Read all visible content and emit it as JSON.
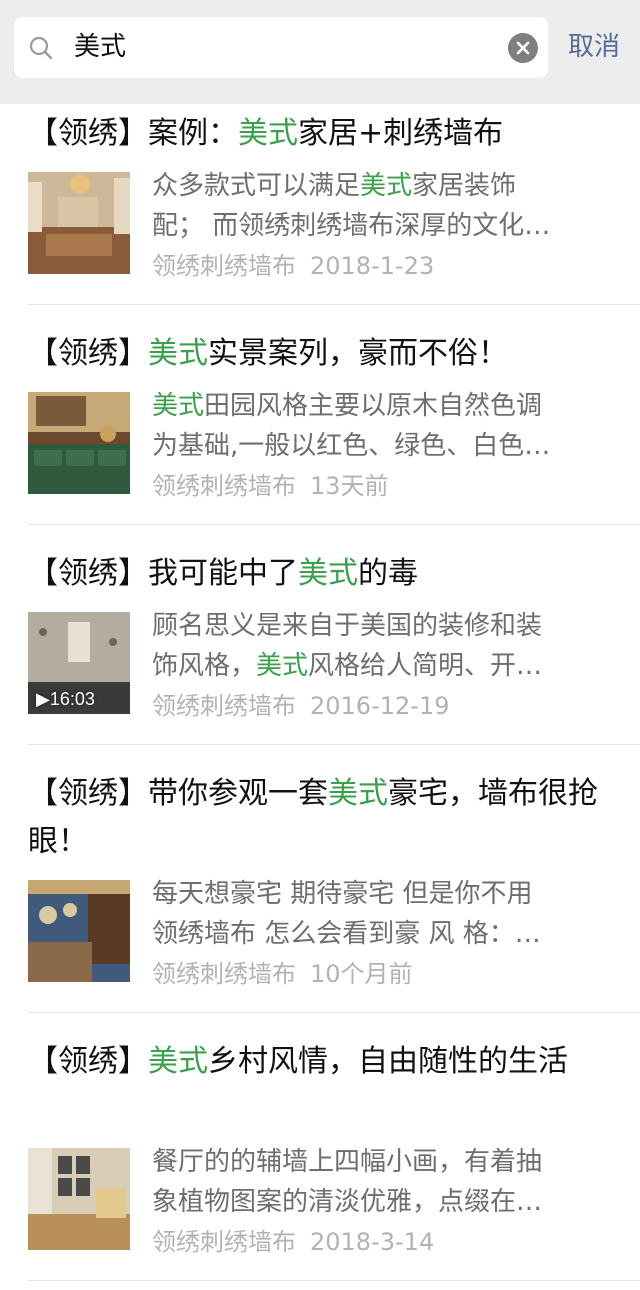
{
  "search": {
    "query": "美式",
    "cancel_label": "取消"
  },
  "results": [
    {
      "title_parts": [
        "【领绣】案例：",
        "美式",
        "家居+刺绣墙布"
      ],
      "desc_lines": [
        [
          "众多款式可以满足",
          "美式",
          "家居装饰"
        ],
        [
          "配； 而领绣刺绣墙布深厚的文化…",
          "",
          ""
        ]
      ],
      "source": "领绣刺绣墙布",
      "date": "2018-1-23"
    },
    {
      "title_parts": [
        "【领绣】",
        "美式",
        "实景案列，豪而不俗！"
      ],
      "desc_lines": [
        [
          "",
          "美式",
          "田园风格主要以原木自然色调"
        ],
        [
          "为基础,一般以红色、绿色、白色…",
          "",
          ""
        ]
      ],
      "source": "领绣刺绣墙布",
      "date": "13天前"
    },
    {
      "title_parts": [
        "【领绣】我可能中了",
        "美式",
        "的毒"
      ],
      "desc_lines": [
        [
          "顾名思义是来自于美国的装修和装",
          "",
          ""
        ],
        [
          "饰风格，",
          "美式",
          "风格给人简明、开…"
        ]
      ],
      "source": "领绣刺绣墙布",
      "date": "2016-12-19",
      "duration": "▶16:03"
    },
    {
      "title_parts": [
        "【领绣】带你参观一套",
        "美式",
        "豪宅，墙布很抢眼！"
      ],
      "desc_lines": [
        [
          "每天想豪宅 期待豪宅 但是你不用",
          "",
          ""
        ],
        [
          "领绣墙布 怎么会看到豪 风 格：…",
          "",
          ""
        ]
      ],
      "source": "领绣刺绣墙布",
      "date": "10个月前"
    },
    {
      "title_parts": [
        "【领绣】",
        "美式",
        "乡村风情，自由随性的生活"
      ],
      "desc_lines": [
        [
          "餐厅的的辅墙上四幅小画，有着抽",
          "",
          ""
        ],
        [
          "象植物图案的清淡优雅，点缀在…",
          "",
          ""
        ]
      ],
      "source": "领绣刺绣墙布",
      "date": "2018-3-14"
    }
  ],
  "colors": {
    "highlight": "#3aa14a",
    "link": "#576b95",
    "meta": "#b2b2b2",
    "desc": "#6e6e6e"
  }
}
